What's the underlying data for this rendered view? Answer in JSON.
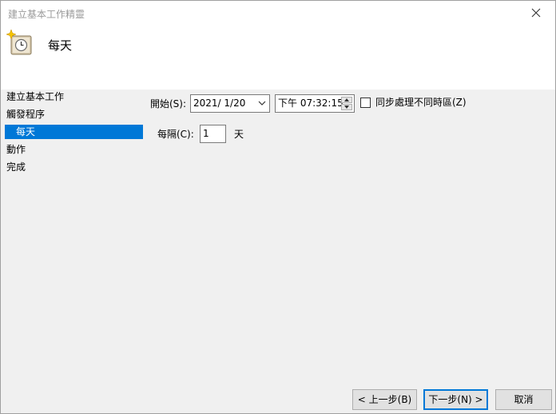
{
  "window": {
    "title": "建立基本工作精靈"
  },
  "header": {
    "title": "每天"
  },
  "nav": {
    "items": [
      {
        "label": "建立基本工作"
      },
      {
        "label": "觸發程序"
      },
      {
        "label": "每天"
      },
      {
        "label": "動作"
      },
      {
        "label": "完成"
      }
    ],
    "selected_index": 2
  },
  "form": {
    "start_label": "開始(S):",
    "start_date": "2021/  1/20",
    "start_time": "下午 07:32:15",
    "sync_label": "同步處理不同時區(Z)",
    "sync_checked": false,
    "interval_label": "每隔(C):",
    "interval_value": "1",
    "interval_unit": "天"
  },
  "buttons": {
    "back": "< 上一步(B)",
    "next": "下一步(N) >",
    "cancel": "取消"
  },
  "colors": {
    "accent": "#0078d7",
    "title_text": "#9a9a9a"
  }
}
